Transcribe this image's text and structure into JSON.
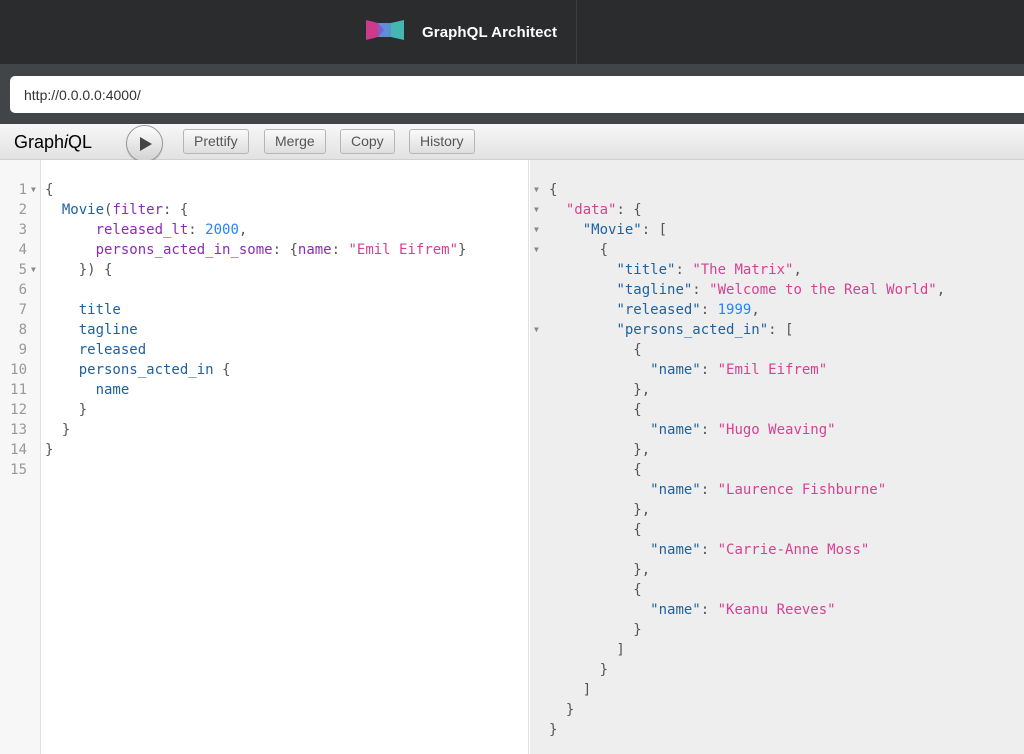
{
  "header": {
    "title": "GraphQL Architect",
    "logo_icon": "graphql-architect-logo-icon"
  },
  "url": {
    "value": "http://0.0.0.0:4000/"
  },
  "toolbar": {
    "logo_prefix": "Graph",
    "logo_italic": "i",
    "logo_suffix": "QL",
    "run_icon": "play-icon",
    "buttons": [
      "Prettify",
      "Merge",
      "Copy",
      "History"
    ]
  },
  "query": {
    "line_numbers": [
      "1",
      "2",
      "3",
      "4",
      "5",
      "6",
      "7",
      "8",
      "9",
      "10",
      "11",
      "12",
      "13",
      "14",
      "15"
    ],
    "lines": [
      [
        [
          "p",
          "{"
        ]
      ],
      [
        [
          "p",
          "  "
        ],
        [
          "f",
          "Movie"
        ],
        [
          "p",
          "("
        ],
        [
          "a",
          "filter"
        ],
        [
          "p",
          ": {"
        ]
      ],
      [
        [
          "p",
          "      "
        ],
        [
          "a",
          "released_lt"
        ],
        [
          "p",
          ": "
        ],
        [
          "n",
          "2000"
        ],
        [
          "p",
          ","
        ]
      ],
      [
        [
          "p",
          "      "
        ],
        [
          "a",
          "persons_acted_in_some"
        ],
        [
          "p",
          ": {"
        ],
        [
          "a",
          "name"
        ],
        [
          "p",
          ": "
        ],
        [
          "s",
          "\"Emil Eifrem\""
        ],
        [
          "p",
          "}"
        ]
      ],
      [
        [
          "p",
          "    }) {"
        ]
      ],
      [
        [
          "p",
          ""
        ]
      ],
      [
        [
          "p",
          "    "
        ],
        [
          "f",
          "title"
        ]
      ],
      [
        [
          "p",
          "    "
        ],
        [
          "f",
          "tagline"
        ]
      ],
      [
        [
          "p",
          "    "
        ],
        [
          "f",
          "released"
        ]
      ],
      [
        [
          "p",
          "    "
        ],
        [
          "f",
          "persons_acted_in"
        ],
        [
          "p",
          " {"
        ]
      ],
      [
        [
          "p",
          "      "
        ],
        [
          "f",
          "name"
        ]
      ],
      [
        [
          "p",
          "    }"
        ]
      ],
      [
        [
          "p",
          "  }"
        ]
      ],
      [
        [
          "p",
          "}"
        ]
      ],
      [
        [
          "p",
          ""
        ]
      ]
    ]
  },
  "result": {
    "lines": [
      [
        [
          "p",
          "{"
        ]
      ],
      [
        [
          "p",
          "  "
        ],
        [
          "s",
          "\"data\""
        ],
        [
          "p",
          ": {"
        ]
      ],
      [
        [
          "p",
          "    "
        ],
        [
          "k",
          "\"Movie\""
        ],
        [
          "p",
          ": ["
        ]
      ],
      [
        [
          "p",
          "      {"
        ]
      ],
      [
        [
          "p",
          "        "
        ],
        [
          "k",
          "\"title\""
        ],
        [
          "p",
          ": "
        ],
        [
          "s",
          "\"The Matrix\""
        ],
        [
          "p",
          ","
        ]
      ],
      [
        [
          "p",
          "        "
        ],
        [
          "k",
          "\"tagline\""
        ],
        [
          "p",
          ": "
        ],
        [
          "s",
          "\"Welcome to the Real World\""
        ],
        [
          "p",
          ","
        ]
      ],
      [
        [
          "p",
          "        "
        ],
        [
          "k",
          "\"released\""
        ],
        [
          "p",
          ": "
        ],
        [
          "n",
          "1999"
        ],
        [
          "p",
          ","
        ]
      ],
      [
        [
          "p",
          "        "
        ],
        [
          "k",
          "\"persons_acted_in\""
        ],
        [
          "p",
          ": ["
        ]
      ],
      [
        [
          "p",
          "          {"
        ]
      ],
      [
        [
          "p",
          "            "
        ],
        [
          "k",
          "\"name\""
        ],
        [
          "p",
          ": "
        ],
        [
          "s",
          "\"Emil Eifrem\""
        ]
      ],
      [
        [
          "p",
          "          },"
        ]
      ],
      [
        [
          "p",
          "          {"
        ]
      ],
      [
        [
          "p",
          "            "
        ],
        [
          "k",
          "\"name\""
        ],
        [
          "p",
          ": "
        ],
        [
          "s",
          "\"Hugo Weaving\""
        ]
      ],
      [
        [
          "p",
          "          },"
        ]
      ],
      [
        [
          "p",
          "          {"
        ]
      ],
      [
        [
          "p",
          "            "
        ],
        [
          "k",
          "\"name\""
        ],
        [
          "p",
          ": "
        ],
        [
          "s",
          "\"Laurence Fishburne\""
        ]
      ],
      [
        [
          "p",
          "          },"
        ]
      ],
      [
        [
          "p",
          "          {"
        ]
      ],
      [
        [
          "p",
          "            "
        ],
        [
          "k",
          "\"name\""
        ],
        [
          "p",
          ": "
        ],
        [
          "s",
          "\"Carrie-Anne Moss\""
        ]
      ],
      [
        [
          "p",
          "          },"
        ]
      ],
      [
        [
          "p",
          "          {"
        ]
      ],
      [
        [
          "p",
          "            "
        ],
        [
          "k",
          "\"name\""
        ],
        [
          "p",
          ": "
        ],
        [
          "s",
          "\"Keanu Reeves\""
        ]
      ],
      [
        [
          "p",
          "          }"
        ]
      ],
      [
        [
          "p",
          "        ]"
        ]
      ],
      [
        [
          "p",
          "      }"
        ]
      ],
      [
        [
          "p",
          "    ]"
        ]
      ],
      [
        [
          "p",
          "  }"
        ]
      ],
      [
        [
          "p",
          "}"
        ]
      ]
    ]
  },
  "colors": {
    "punctuation": "#555555",
    "field": "#1f61a0",
    "argument": "#8b2bb9",
    "number": "#2882f9",
    "string": "#d64292"
  }
}
